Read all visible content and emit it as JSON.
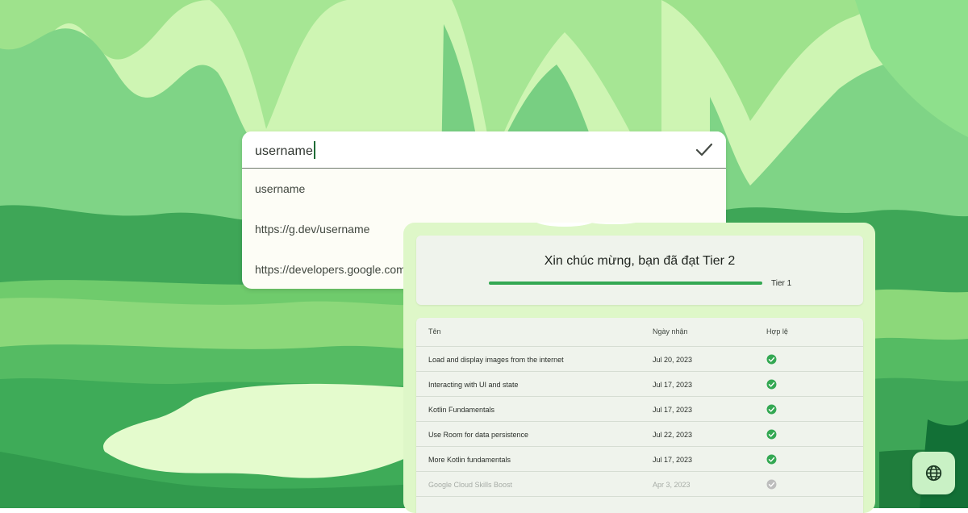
{
  "url_input": {
    "value": "username",
    "suggestions": [
      "username",
      "https://g.dev/username",
      "https://developers.google.com/profile/u/username"
    ]
  },
  "badge_card": {
    "title": "Xin chúc mừng, bạn đã đạt Tier 2",
    "progress_fraction": 1.0,
    "progress_label": "Tier 1",
    "table": {
      "headers": [
        "Tên",
        "Ngày nhận",
        "Hợp lệ"
      ],
      "rows": [
        {
          "name": "Load and display images from the internet",
          "date": "Jul 20, 2023",
          "valid": true
        },
        {
          "name": "Interacting with UI and state",
          "date": "Jul 17, 2023",
          "valid": true
        },
        {
          "name": "Kotlin Fundamentals",
          "date": "Jul 17, 2023",
          "valid": true
        },
        {
          "name": "Use Room for data persistence",
          "date": "Jul 22, 2023",
          "valid": true
        },
        {
          "name": "More Kotlin fundamentals",
          "date": "Jul 17, 2023",
          "valid": true
        },
        {
          "name": "Google Cloud Skills Boost",
          "date": "Apr 3, 2023",
          "valid": false
        }
      ]
    }
  },
  "icons": {
    "confirm": "check-icon",
    "valid": "check-circle-icon",
    "language": "globe-icon"
  },
  "colors": {
    "accent_green": "#34a853",
    "card_bg": "#def7c8",
    "valid_check": "#34a853",
    "invalid_check": "#bdbdbd"
  }
}
